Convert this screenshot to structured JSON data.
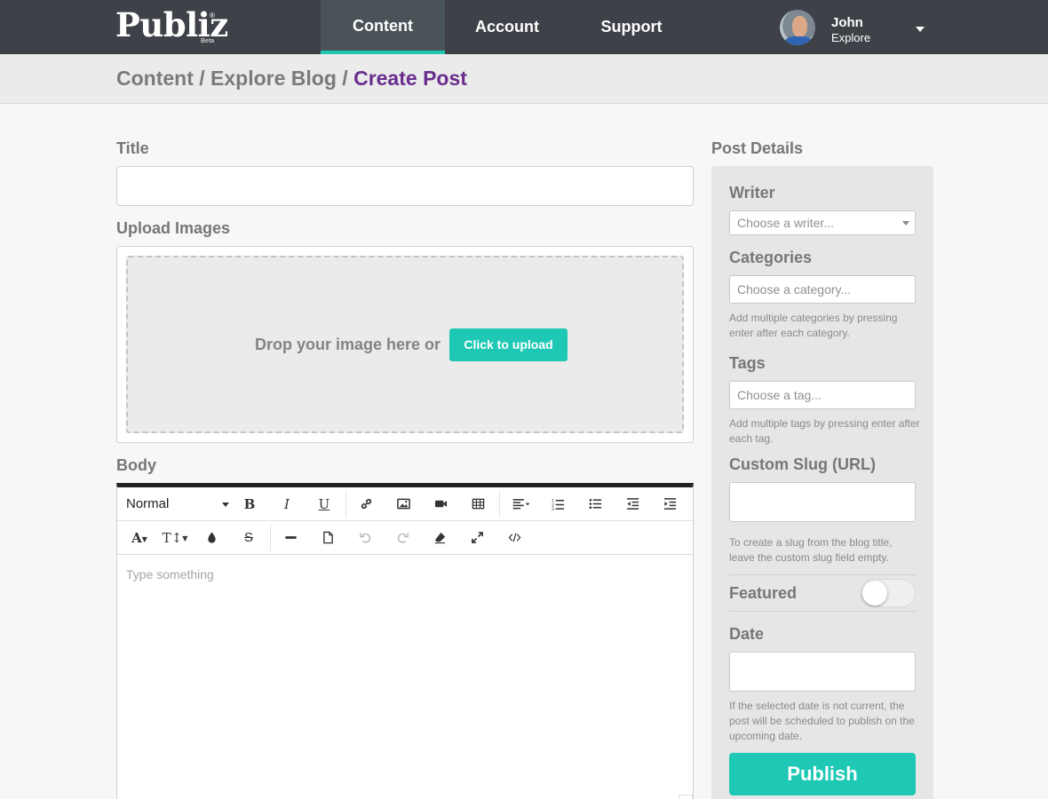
{
  "header": {
    "logo": "Publiz",
    "logo_mark": "®",
    "logo_badge": "Beta",
    "tabs": [
      {
        "label": "Content",
        "active": true
      },
      {
        "label": "Account",
        "active": false
      },
      {
        "label": "Support",
        "active": false
      }
    ],
    "user": {
      "name": "John",
      "role": "Explore"
    },
    "accent_color": "#1ec8b5"
  },
  "breadcrumb": {
    "items": [
      "Content",
      "Explore Blog"
    ],
    "separator": " / ",
    "current": "Create Post",
    "current_color": "#6a2d8e"
  },
  "form": {
    "title_label": "Title",
    "title_value": "",
    "upload_label": "Upload Images",
    "drop_text": "Drop your image here or",
    "upload_button": "Click to upload",
    "body_label": "Body",
    "editor": {
      "format_select": "Normal",
      "placeholder": "Type something",
      "row1_icons": [
        "bold-icon",
        "italic-icon",
        "underline-icon",
        "link-icon",
        "image-icon",
        "video-icon",
        "table-icon",
        "align-icon",
        "ordered-list-icon",
        "bullet-list-icon",
        "outdent-icon",
        "indent-icon"
      ],
      "row2_icons": [
        "font-color-icon",
        "font-size-icon",
        "color-drop-icon",
        "strikethrough-icon",
        "horizontal-rule-icon",
        "page-icon",
        "undo-icon",
        "redo-icon",
        "eraser-icon",
        "fullscreen-icon",
        "code-view-icon"
      ]
    }
  },
  "details": {
    "heading": "Post Details",
    "writer": {
      "label": "Writer",
      "placeholder": "Choose a writer..."
    },
    "categories": {
      "label": "Categories",
      "placeholder": "Choose a category...",
      "help": "Add multiple categories by pressing enter after each category."
    },
    "tags": {
      "label": "Tags",
      "placeholder": "Choose a tag...",
      "help": "Add multiple tags by pressing enter after each tag."
    },
    "slug": {
      "label": "Custom Slug (URL)",
      "value": "",
      "help": "To create a slug from the blog title, leave the custom slug field empty."
    },
    "featured": {
      "label": "Featured",
      "on": false
    },
    "date": {
      "label": "Date",
      "value": "",
      "help": "If the selected date is not current, the post will be scheduled to publish on the upcoming date."
    },
    "publish_button": "Publish"
  }
}
